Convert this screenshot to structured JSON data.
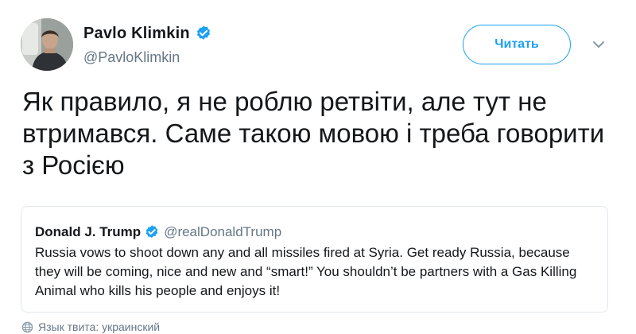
{
  "author": {
    "display_name": "Pavlo Klimkin",
    "handle": "@PavloKlimkin",
    "verified": true
  },
  "follow_button": {
    "label": "Читать"
  },
  "tweet": {
    "text": "Як правило, я не роблю ретвіти, але тут не втримався. Саме такою мовою і треба говорити з Росією"
  },
  "quoted_tweet": {
    "display_name": "Donald J. Trump",
    "handle": "@realDonaldTrump",
    "verified": true,
    "text": "Russia vows to shoot down any and all missiles fired at Syria. Get ready Russia, because they will be coming, nice and new and “smart!” You shouldn’t be partners with a Gas Killing Animal who kills his people and enjoys it!"
  },
  "language": {
    "label": "Язык твита: украинский"
  },
  "icons": {
    "verified": "verified-badge-icon",
    "caret": "chevron-down-icon",
    "globe": "globe-icon"
  },
  "colors": {
    "accent": "#1da1f2",
    "secondary_text": "#657786",
    "border": "#e1e8ed",
    "text": "#14171a"
  }
}
